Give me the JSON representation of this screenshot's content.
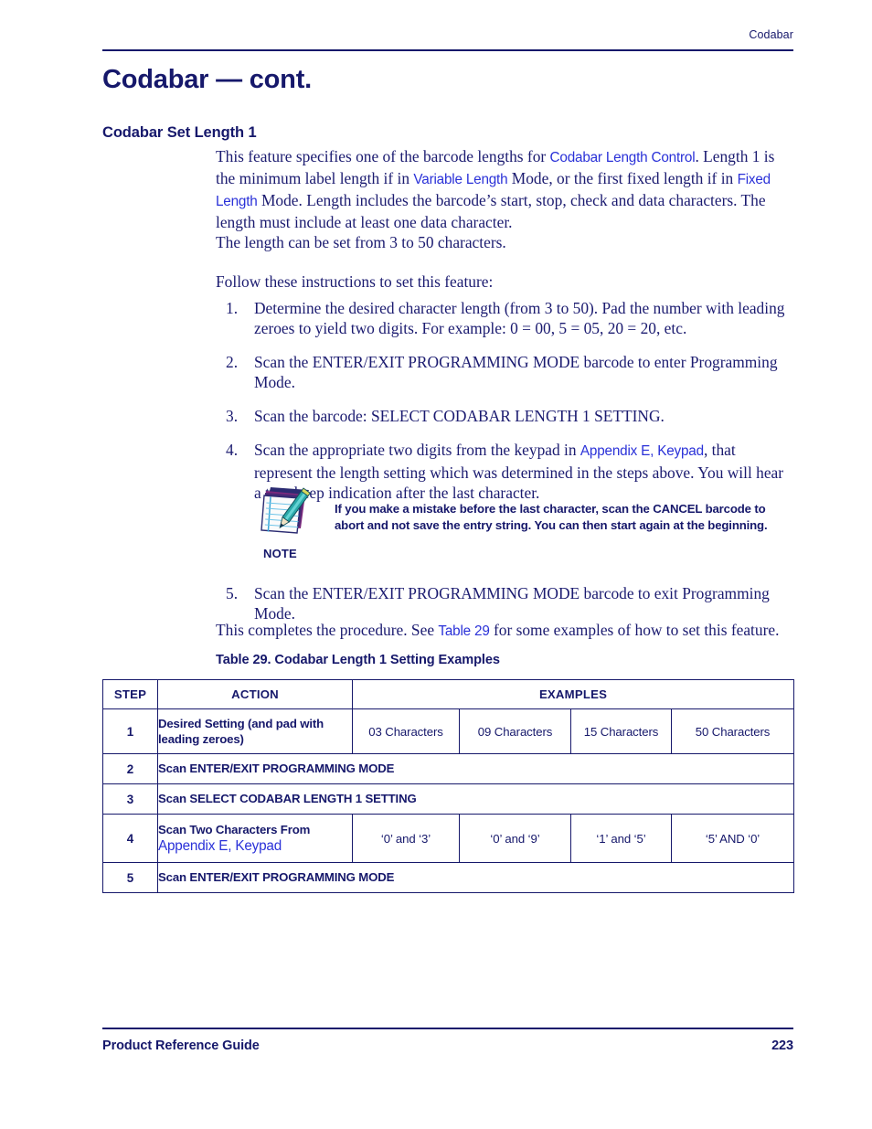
{
  "header": {
    "running_head": "Codabar"
  },
  "chapter_title": "Codabar — cont.",
  "section_heading": "Codabar Set Length 1",
  "intro": {
    "l1_a": "This feature specifies one of the barcode lengths for ",
    "link_codabar_length_control": "Codabar Length Control",
    "l1_b": ". Length 1 is the minimum label length if in ",
    "link_variable_length": "Variable Length",
    "l1_c": " Mode, or the first fixed length if in ",
    "link_fixed_length": "Fixed Length",
    "l1_d": " Mode. Length includes the barcode’s start, stop, check and data characters. The length must include at least one data character.",
    "l2": "The length can be set from 3 to 50 characters.",
    "follow": "Follow these instructions to set this feature:"
  },
  "steps": [
    {
      "num": "1.",
      "text": "Determine the desired character length (from 3 to 50). Pad the number with leading zeroes to yield two digits. For example: 0 = 00, 5 = 05, 20 = 20, etc."
    },
    {
      "num": "2.",
      "text": "Scan the ENTER/EXIT PROGRAMMING MODE barcode to enter Programming Mode."
    },
    {
      "num": "3.",
      "text": "Scan the barcode: SELECT CODABAR LENGTH 1 SETTING."
    },
    {
      "num": "4.",
      "text_a": "Scan the appropriate two digits from the keypad in ",
      "link": "Appendix E, Keypad",
      "text_b": ", that represent the length setting which was determined in the steps above. You will hear a two-beep indication after the last character."
    },
    {
      "num": "5.",
      "text": "Scan the ENTER/EXIT PROGRAMMING MODE barcode to exit Programming Mode."
    }
  ],
  "note": {
    "label": "NOTE",
    "icon": "notepad-pencil-icon",
    "text": "If you make a mistake before the last character, scan the CANCEL barcode to abort and not save the entry string. You can then start again at the beginning."
  },
  "closing": {
    "a": "This completes the procedure. See ",
    "link_table": "Table 29",
    "b": " for some examples of how to set this feature."
  },
  "table": {
    "caption": "Table 29. Codabar Length 1 Setting Examples",
    "headers": {
      "step": "STEP",
      "action": "ACTION",
      "examples": "EXAMPLES"
    },
    "rows": [
      {
        "step": "1",
        "action": "Desired Setting (and pad with leading zeroes)",
        "examples": [
          "03 Characters",
          "09 Characters",
          "15 Characters",
          "50 Characters"
        ]
      },
      {
        "step": "2",
        "action": "Scan ENTER/EXIT PROGRAMMING MODE",
        "examples": []
      },
      {
        "step": "3",
        "action": "Scan SELECT CODABAR LENGTH 1 SETTING",
        "examples": []
      },
      {
        "step": "4",
        "action": "Scan Two Characters From",
        "action_link": "Appendix E, Keypad",
        "examples": [
          "‘0’ and ‘3’",
          "‘0’ and ‘9’",
          "‘1’ and ‘5’",
          "‘5’ AND ‘0’"
        ]
      },
      {
        "step": "5",
        "action": "Scan ENTER/EXIT PROGRAMMING MODE",
        "examples": []
      }
    ]
  },
  "footer": {
    "guide": "Product Reference Guide",
    "page": "223"
  },
  "colors": {
    "navy": "#16186b",
    "body_navy": "#1b1b70",
    "link_blue": "#2a31d8"
  }
}
